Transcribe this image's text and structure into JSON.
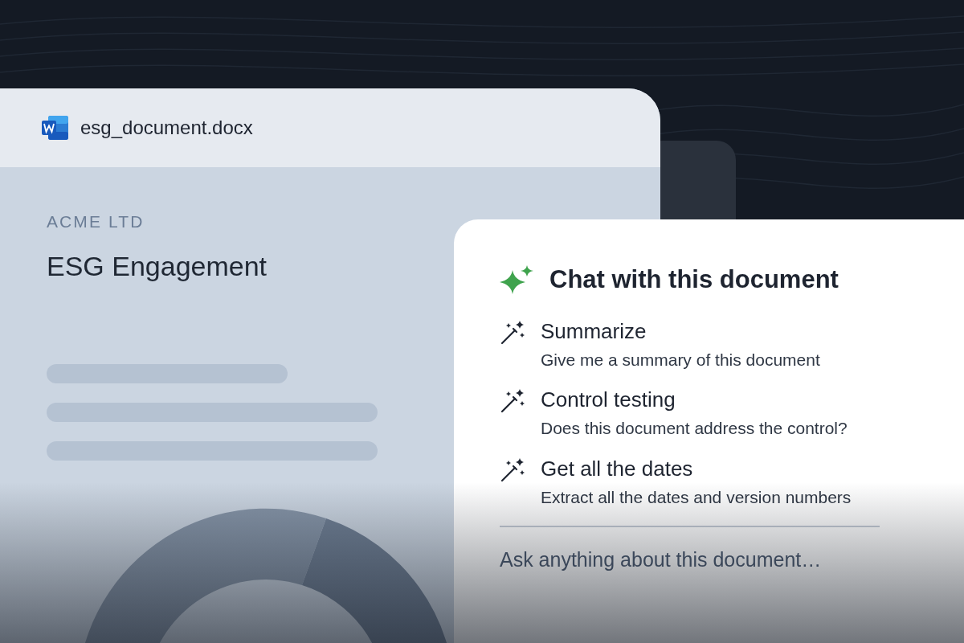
{
  "file": {
    "name": "esg_document.docx"
  },
  "document": {
    "company": "ACME LTD",
    "title": "ESG Engagement"
  },
  "chat": {
    "title": "Chat with this document",
    "suggestions": [
      {
        "title": "Summarize",
        "description": "Give me a summary of this document"
      },
      {
        "title": "Control testing",
        "description": "Does this document address the control?"
      },
      {
        "title": "Get all the dates",
        "description": "Extract all the dates and version numbers"
      }
    ],
    "input": {
      "placeholder": "Ask anything about this document…"
    }
  }
}
